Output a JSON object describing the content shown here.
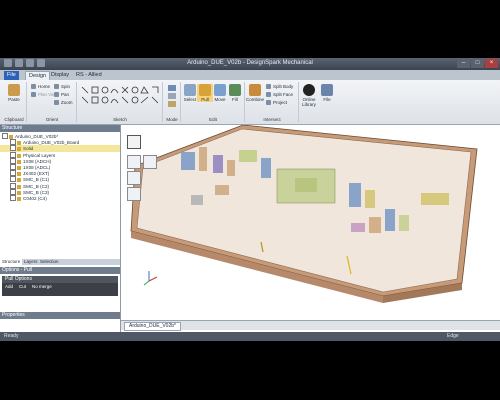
{
  "window": {
    "title": "Arduino_DUE_V02b - DesignSpark Mechanical"
  },
  "menu_tabs": [
    "File",
    "Design",
    "Display",
    "RS - Allied"
  ],
  "ribbon": {
    "clipboard": {
      "label": "Clipboard",
      "paste": "Paste"
    },
    "orient": {
      "label": "Orient",
      "home": "Home",
      "spin": "Spin",
      "plan_view": "Plan View",
      "pan": "Pan",
      "zoom": "Zoom"
    },
    "sketch": {
      "label": "Sketch"
    },
    "mode": {
      "label": "Mode"
    },
    "edit": {
      "label": "Edit",
      "select": "Select",
      "pull": "Pull",
      "move": "Move",
      "fill": "Fill"
    },
    "intersect": {
      "label": "Intersect",
      "combine": "Combine",
      "split_body": "Split Body",
      "split_face": "Split Face",
      "project": "Project"
    },
    "insert": {
      "online_library": "Online Library",
      "file": "File"
    }
  },
  "structure": {
    "header": "Structure",
    "items": [
      "Arduino_DUE_V02b*",
      "Arduino_DUE_V02b_Board",
      "Solid",
      "Physical Layers",
      "1X08 (ADCH)",
      "1X08 (ADCL)",
      "JX402 (EXT)",
      "SMC_B (C1)",
      "SMC_B (C2)",
      "SMC_B (C3)",
      "C0402 (C4)"
    ]
  },
  "panel_tabs": [
    "Structure",
    "Layers",
    "Selection"
  ],
  "options": {
    "header": "Options - Pull",
    "pull_options": "Pull Options",
    "add": "Add",
    "cut": "Cut",
    "no_merge": "No merge"
  },
  "properties": {
    "header": "Properties"
  },
  "doc_tab": "Arduino_DUE_V02b*",
  "status": {
    "ready": "Ready",
    "edge": "Edge"
  },
  "colors": {
    "accent": "#2d62b8",
    "status_bar": "#4f5864",
    "enclosure": "#d9a77e"
  }
}
